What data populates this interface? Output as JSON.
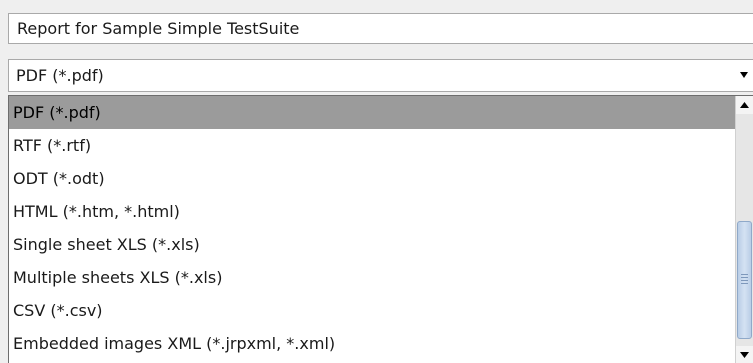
{
  "report_title": {
    "value": "Report for Sample Simple TestSuite"
  },
  "format_combo": {
    "selected_value": "PDF (*.pdf)",
    "arrow_icon": "triangle-down-icon"
  },
  "format_list": {
    "selected_index": 0,
    "options": [
      "PDF (*.pdf)",
      "RTF (*.rtf)",
      "ODT (*.odt)",
      "HTML (*.htm, *.html)",
      "Single sheet XLS (*.xls)",
      "Multiple sheets XLS (*.xls)",
      "CSV (*.csv)",
      "Embedded images XML (*.jrpxml, *.xml)"
    ],
    "scroll": {
      "up_icon": "triangle-up-icon",
      "down_icon": "triangle-down-icon"
    }
  },
  "colors": {
    "selection_background": "#9b9b9b",
    "thumb": "#c6d7ee"
  }
}
